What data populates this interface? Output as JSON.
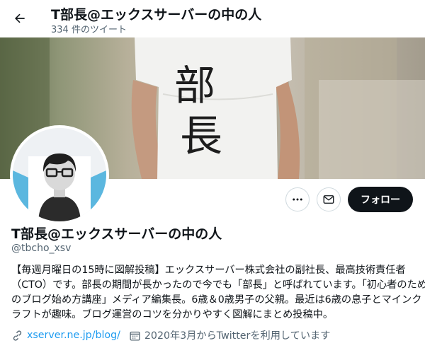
{
  "header": {
    "title": "T部長@エックスサーバーの中の人",
    "tweet_count": "334 件のツイート",
    "back_icon": "arrow-left-icon"
  },
  "banner": {
    "shirt_text_1": "部",
    "shirt_text_2": "長"
  },
  "profile": {
    "name": "T部長@エックスサーバーの中の人",
    "handle": "@tbcho_xsv",
    "bio_lines": [
      "【毎週月曜日の15時に図解投稿】エックスサーバー株式会社の副社長、最高技術責任者",
      "（CTO）です。部長の期間が長かったので今でも「部長」と呼ばれています。「初心者のため",
      "のブログ始め方講座」メディア編集長。6歳＆0歳男子の父親。最近は6歳の息子とマインク",
      "ラフトが趣味。ブログ運営のコツを分かりやすく図解にまとめ投稿中。"
    ],
    "link": "xserver.ne.jp/blog/",
    "joined": "2020年3月からTwitterを利用しています"
  },
  "actions": {
    "more_icon": "more-icon",
    "message_icon": "mail-icon",
    "follow_label": "フォロー"
  },
  "colors": {
    "accent": "#1d9bf0",
    "follow_bg": "#0f1419",
    "secondary_text": "#536471"
  }
}
